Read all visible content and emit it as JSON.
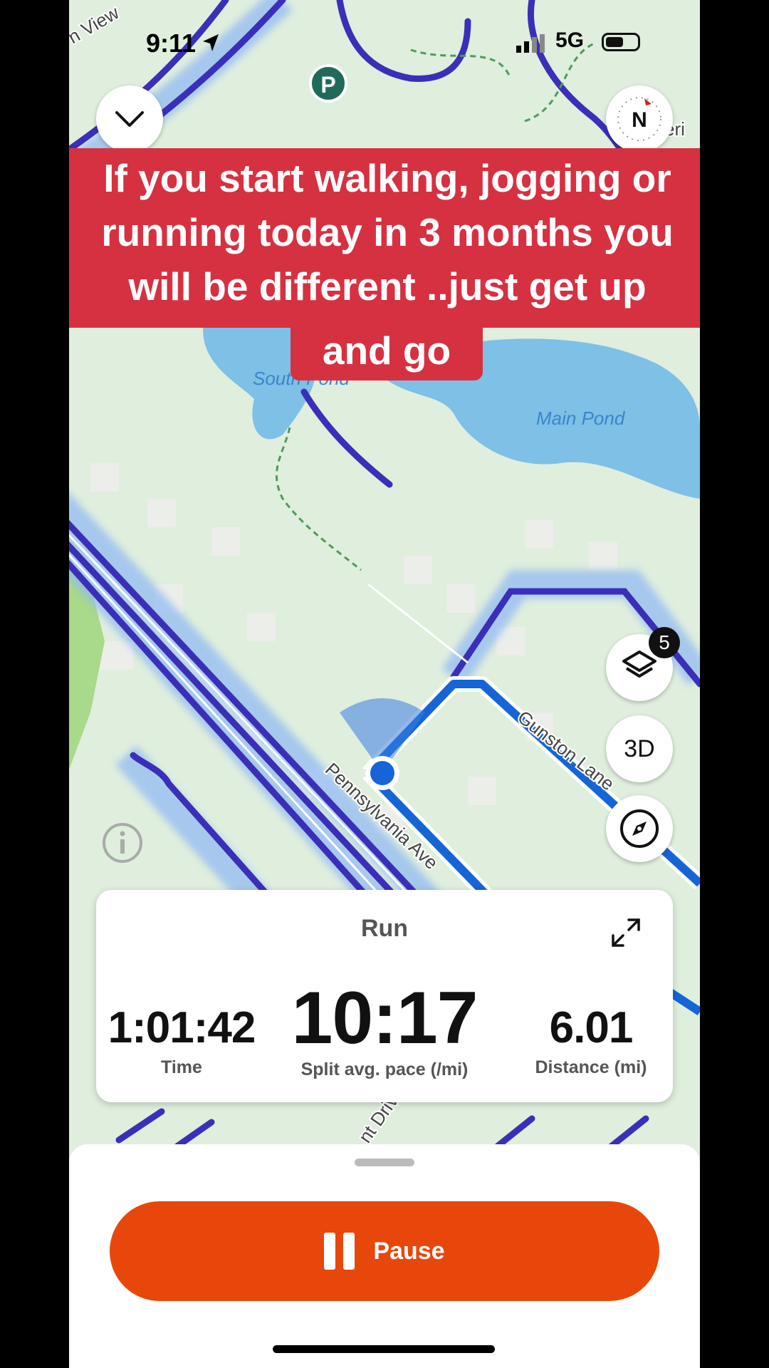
{
  "status_bar": {
    "time": "9:11",
    "network": "5G"
  },
  "map": {
    "labels": {
      "south_pond": "South Pond",
      "main_pond": "Main Pond",
      "pennsylvania": "Pennsylvania Ave",
      "gunston": "Gunston Lane",
      "drive": "nt Driv",
      "view": "n View",
      "peri": "eri"
    },
    "parking_label": "P",
    "compass_label": "N",
    "layers_count": "5",
    "btn_3d": "3D"
  },
  "caption": {
    "lines": [
      "If you start walking, jogging or",
      "running today in 3 months you",
      "will be different ..just get up"
    ],
    "last_line": "and go"
  },
  "stats": {
    "activity": "Run",
    "time_value": "1:01:42",
    "time_label": "Time",
    "pace_value": "10:17",
    "pace_label": "Split avg. pace (/mi)",
    "distance_value": "6.01",
    "distance_label": "Distance (mi)"
  },
  "controls": {
    "pause_label": "Pause"
  },
  "colors": {
    "pause": "#e8470c",
    "caption_bg": "#d63141",
    "heatmap": "#3a2fb8",
    "route": "#1565d8",
    "water": "#7ec0e6"
  }
}
